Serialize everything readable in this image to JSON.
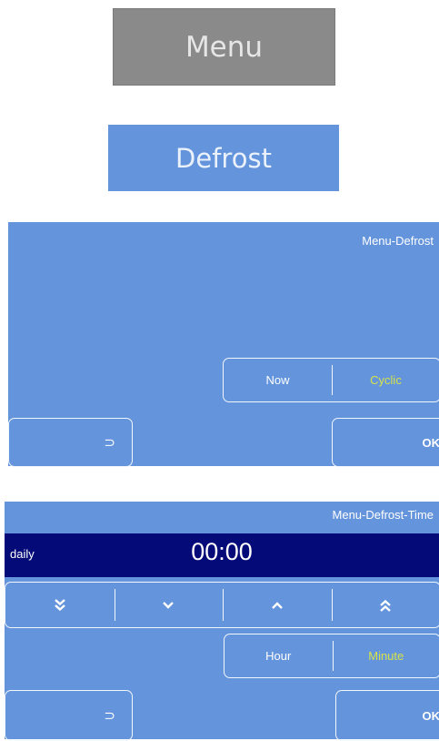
{
  "menu_button": {
    "label": "Menu"
  },
  "defrost_button": {
    "label": "Defrost"
  },
  "screen1": {
    "breadcrumb": "Menu-Defrost",
    "mode_options": [
      {
        "label": "Now",
        "active": false
      },
      {
        "label": "Cyclic",
        "active": true
      }
    ],
    "back_glyph": "⊃",
    "ok_label": "OK"
  },
  "screen2": {
    "breadcrumb": "Menu-Defrost-Time",
    "schedule": "daily",
    "time": "00:00",
    "arrows": [
      "double-chevron-down-icon",
      "chevron-down-icon",
      "chevron-up-icon",
      "double-chevron-up-icon"
    ],
    "unit_options": [
      {
        "label": "Hour",
        "active": false
      },
      {
        "label": "Minute",
        "active": true
      }
    ],
    "back_glyph": "⊃",
    "ok_label": "OK"
  },
  "colors": {
    "panel": "#6494dc",
    "menu_gray": "#8a8a8a",
    "time_bar": "#040a78",
    "active_text": "#d6e24a"
  }
}
